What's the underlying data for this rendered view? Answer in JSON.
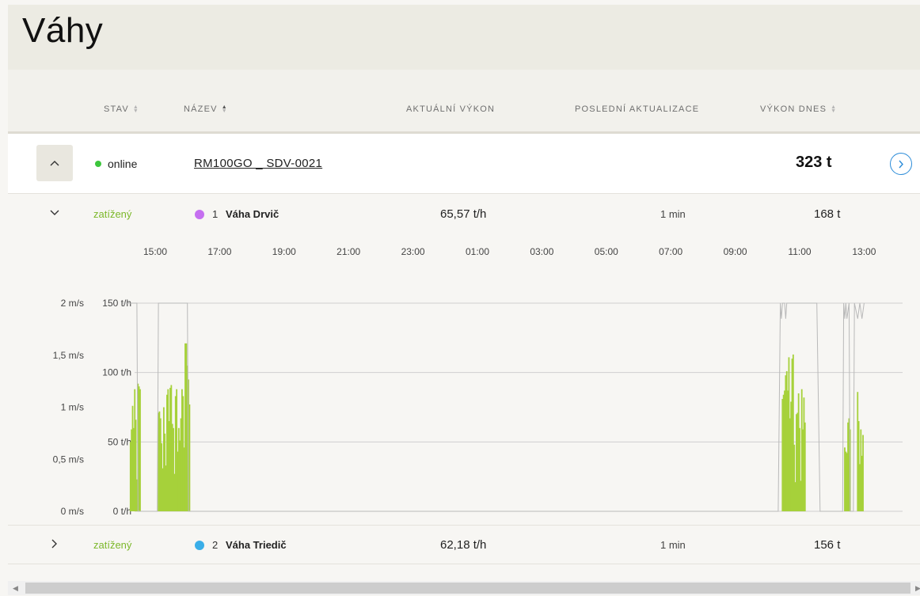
{
  "page": {
    "title": "Váhy"
  },
  "columns": {
    "status": "STAV",
    "name": "NÁZEV",
    "current_power": "AKTUÁLNÍ VÝKON",
    "last_update": "POSLEDNÍ AKTUALIZACE",
    "power_today": "VÝKON DNES"
  },
  "scale": {
    "status": "online",
    "name": "RM100GO _ SDV-0021",
    "total_today": "323 t"
  },
  "weighers": [
    {
      "state": "zatížený",
      "number": "1",
      "name": "Váha Drvič",
      "current_power": "65,57 t/h",
      "last_update": "1 min",
      "today": "168 t",
      "color": "#c56ff0",
      "expanded": true
    },
    {
      "state": "zatížený",
      "number": "2",
      "name": "Váha Triedič",
      "current_power": "62,18 t/h",
      "last_update": "1 min",
      "today": "156 t",
      "color": "#3aaee8",
      "expanded": false
    }
  ],
  "colors": {
    "accent": "#2a8bd8",
    "online": "#3cc63c",
    "loaded": "#7cb82a",
    "bar": "#a6d13a"
  },
  "chart_data": {
    "type": "bar",
    "x_ticks": [
      "15:00",
      "17:00",
      "19:00",
      "21:00",
      "23:00",
      "01:00",
      "03:00",
      "05:00",
      "07:00",
      "09:00",
      "11:00",
      "13:00"
    ],
    "y_left_ticks": [
      "0 t/h",
      "50 t/h",
      "100 t/h",
      "150 t/h"
    ],
    "y_right_ticks": [
      "0 m/s",
      "0,5 m/s",
      "1 m/s",
      "1,5 m/s",
      "2 m/s"
    ],
    "ylim_tph": [
      0,
      150
    ],
    "ylim_speed": [
      0,
      2
    ],
    "grid": true,
    "bar_series": {
      "name": "",
      "times": [
        "14:14",
        "14:16",
        "14:18",
        "14:20",
        "14:22",
        "14:24",
        "14:26",
        "14:28",
        "14:30",
        "14:32",
        "15:06",
        "15:08",
        "15:10",
        "15:12",
        "15:14",
        "15:16",
        "15:18",
        "15:20",
        "15:22",
        "15:24",
        "15:26",
        "15:28",
        "15:30",
        "15:32",
        "15:34",
        "15:36",
        "15:38",
        "15:40",
        "15:42",
        "15:44",
        "15:46",
        "15:48",
        "15:50",
        "15:52",
        "15:54",
        "15:56",
        "15:58",
        "16:00",
        "16:02",
        "16:04",
        "10:28",
        "10:30",
        "10:32",
        "10:34",
        "10:36",
        "10:38",
        "10:40",
        "10:42",
        "10:44",
        "10:46",
        "10:48",
        "10:50",
        "10:52",
        "10:54",
        "10:56",
        "10:58",
        "11:00",
        "11:02",
        "11:04",
        "11:06",
        "11:08",
        "11:10",
        "12:24",
        "12:26",
        "12:28",
        "12:30",
        "12:32",
        "12:34",
        "12:48",
        "12:50",
        "12:52",
        "12:54",
        "12:56",
        "12:58"
      ],
      "values": [
        50,
        59,
        76,
        60,
        88,
        66,
        23,
        92,
        90,
        88,
        71,
        72,
        67,
        49,
        31,
        75,
        56,
        33,
        84,
        88,
        65,
        89,
        91,
        63,
        60,
        27,
        83,
        88,
        43,
        60,
        51,
        67,
        88,
        83,
        46,
        121,
        121,
        105,
        95,
        77,
        81,
        84,
        87,
        98,
        101,
        87,
        111,
        67,
        79,
        110,
        113,
        48,
        21,
        70,
        71,
        85,
        60,
        22,
        88,
        59,
        82,
        64,
        46,
        43,
        42,
        64,
        67,
        59,
        86,
        65,
        34,
        59,
        40,
        55
      ]
    },
    "speed_series": {
      "name": "",
      "times": [
        "14:00",
        "14:26",
        "14:28",
        "14:32",
        "14:34",
        "15:04",
        "15:06",
        "16:00",
        "16:02",
        "16:06",
        "10:20",
        "10:24",
        "10:26",
        "10:28",
        "10:32",
        "10:34",
        "10:36",
        "11:32",
        "11:38",
        "12:20",
        "12:22",
        "12:24",
        "12:26",
        "12:28",
        "12:32",
        "12:34",
        "12:40",
        "12:42",
        "12:48",
        "12:52",
        "12:56",
        "13:00"
      ],
      "values": [
        2,
        2,
        0,
        0,
        0,
        0,
        2,
        2,
        0,
        0,
        0,
        2,
        1.85,
        2,
        2,
        1.85,
        2,
        2,
        0,
        0,
        2,
        1.85,
        2,
        1.85,
        2,
        0,
        0,
        2,
        1.85,
        2,
        1.85,
        2
      ]
    }
  }
}
